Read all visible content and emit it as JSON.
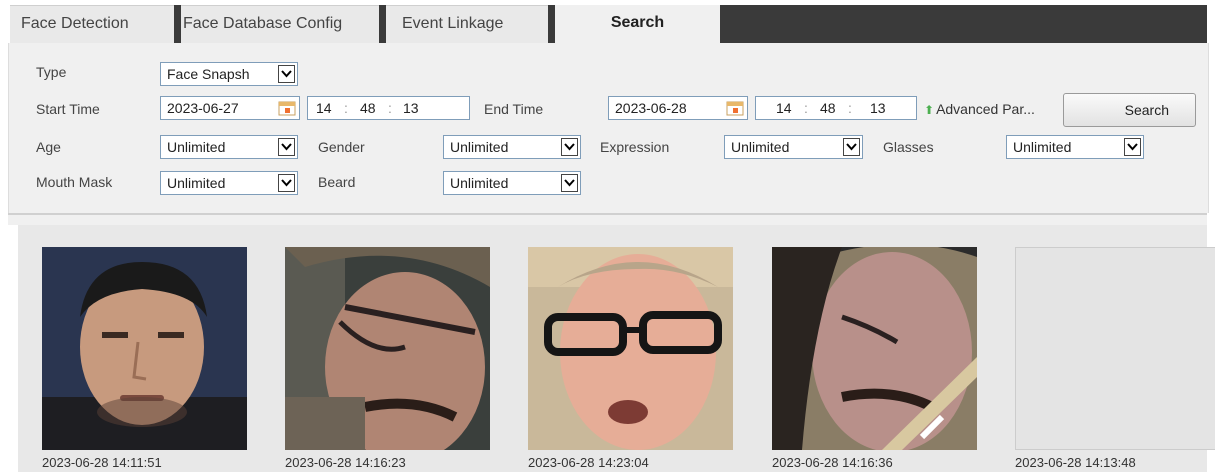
{
  "tabs": [
    {
      "label": "Face Detection"
    },
    {
      "label": "Face Database Config"
    },
    {
      "label": "Event Linkage"
    },
    {
      "label": "Search",
      "active": true
    }
  ],
  "filters": {
    "type_label": "Type",
    "type_value": "Face Snapsh",
    "start_time_label": "Start Time",
    "start_date": "2023-06-27",
    "start_hour": "14",
    "start_min": "48",
    "start_sec": "13",
    "end_time_label": "End Time",
    "end_date": "2023-06-28",
    "end_hour": "14",
    "end_min": "48",
    "end_sec": "13",
    "advanced_label": "Advanced Par...",
    "search_button": "Search",
    "age_label": "Age",
    "age_value": "Unlimited",
    "gender_label": "Gender",
    "gender_value": "Unlimited",
    "expression_label": "Expression",
    "expression_value": "Unlimited",
    "glasses_label": "Glasses",
    "glasses_value": "Unlimited",
    "mouth_mask_label": "Mouth Mask",
    "mouth_mask_value": "Unlimited",
    "beard_label": "Beard",
    "beard_value": "Unlimited"
  },
  "results": [
    {
      "timestamp": "2023-06-28 14:11:51",
      "thumbnail": "face-snapshot"
    },
    {
      "timestamp": "2023-06-28 14:16:23",
      "thumbnail": "face-snapshot"
    },
    {
      "timestamp": "2023-06-28 14:23:04",
      "thumbnail": "face-snapshot"
    },
    {
      "timestamp": "2023-06-28 14:16:36",
      "thumbnail": "face-snapshot"
    },
    {
      "timestamp": "2023-06-28 14:13:48",
      "thumbnail": "empty"
    }
  ],
  "colors": {
    "tab_dark": "#3a3a3a",
    "panel_bg": "#f0f0f0",
    "advanced_icon": "#4caf50"
  }
}
